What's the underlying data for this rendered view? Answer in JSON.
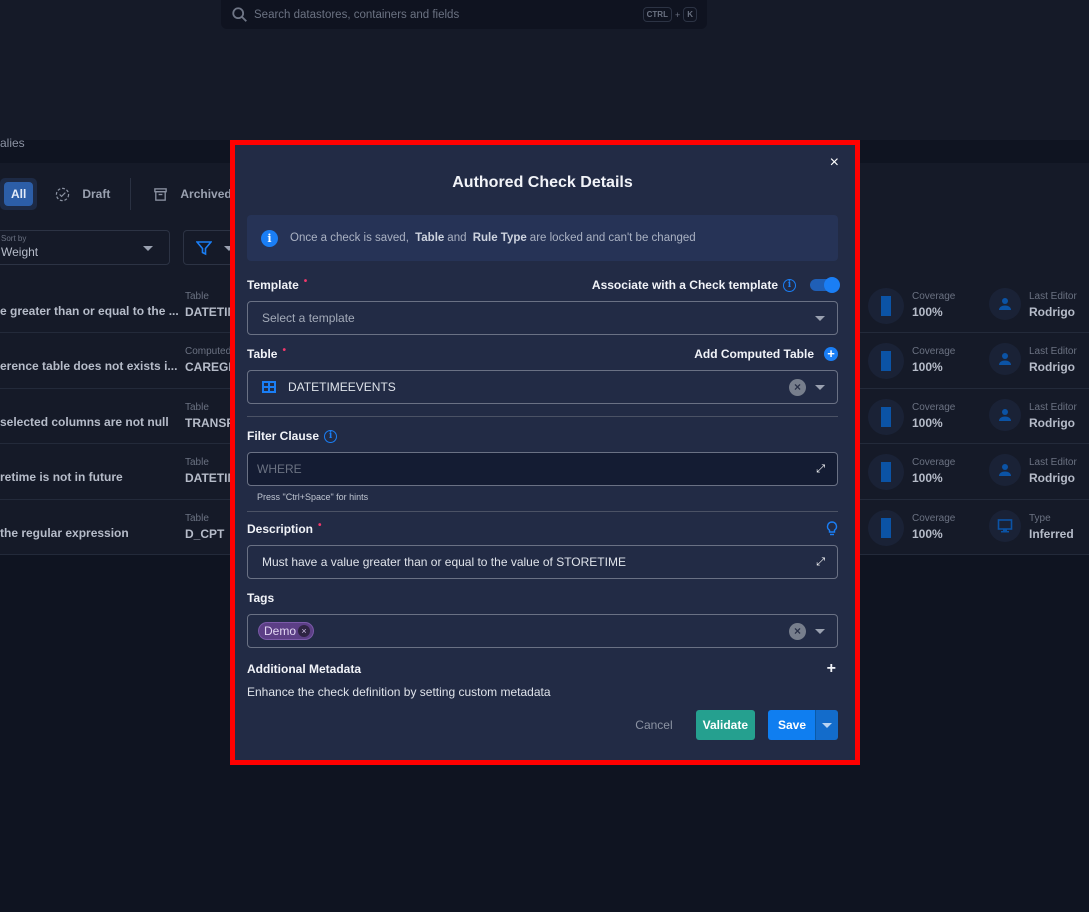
{
  "search": {
    "placeholder": "Search datastores, containers and fields",
    "shortcut_key1": "CTRL",
    "shortcut_plus": "+",
    "shortcut_key2": "K"
  },
  "page": {
    "title_fragment": "alies"
  },
  "tabs": [
    {
      "label": "All",
      "active": true
    },
    {
      "label": "Draft",
      "icon": "draft-circle-icon"
    },
    {
      "label": "Archived",
      "icon": "archive-icon"
    }
  ],
  "sort": {
    "label": "Sort by",
    "value": "Weight"
  },
  "rows": [
    {
      "name": "e greater than or equal to the ...",
      "container_label": "Table",
      "container": "DATETIM",
      "coverage_label": "Coverage",
      "coverage": "100%",
      "meta_label": "Last Editor",
      "meta_value": "Rodrigo",
      "meta_icon": "user-icon"
    },
    {
      "name": "erence table does not exists i...",
      "container_label": "Computed",
      "container": "CAREGIV",
      "coverage_label": "Coverage",
      "coverage": "100%",
      "meta_label": "Last Editor",
      "meta_value": "Rodrigo",
      "meta_icon": "user-icon"
    },
    {
      "name": "selected columns are not null",
      "container_label": "Table",
      "container": "TRANSFI",
      "coverage_label": "Coverage",
      "coverage": "100%",
      "meta_label": "Last Editor",
      "meta_value": "Rodrigo",
      "meta_icon": "user-icon"
    },
    {
      "name": "retime is not in future",
      "container_label": "Table",
      "container": "DATETIM",
      "coverage_label": "Coverage",
      "coverage": "100%",
      "meta_label": "Last Editor",
      "meta_value": "Rodrigo",
      "meta_icon": "user-icon"
    },
    {
      "name": "the regular expression",
      "container_label": "Table",
      "container": "D_CPT",
      "coverage_label": "Coverage",
      "coverage": "100%",
      "meta_label": "Type",
      "meta_value": "Inferred",
      "meta_icon": "monitor-icon"
    }
  ],
  "modal": {
    "title": "Authored Check Details",
    "close_label": "×",
    "info": {
      "prefix": "Once a check is saved,",
      "bold1": "Table",
      "mid": "and",
      "bold2": "Rule Type",
      "suffix": "are locked and can't be changed"
    },
    "template": {
      "label": "Template",
      "required_mark": "•",
      "associate_label": "Associate with a Check template",
      "associate_enabled": true,
      "placeholder": "Select a template"
    },
    "table": {
      "label": "Table",
      "required_mark": "•",
      "add_computed_label": "Add Computed Table",
      "value": "DATETIMEEVENTS"
    },
    "filter": {
      "label": "Filter Clause",
      "placeholder": "WHERE",
      "hint": "Press \"Ctrl+Space\" for hints"
    },
    "description": {
      "label": "Description",
      "required_mark": "•",
      "value": "Must have a value greater than or equal to the value of STORETIME"
    },
    "tags": {
      "label": "Tags",
      "items": [
        "Demo"
      ]
    },
    "metadata": {
      "label": "Additional Metadata",
      "add_label": "+",
      "description": "Enhance the check definition by setting custom metadata"
    },
    "footer": {
      "cancel_label": "Cancel",
      "validate_label": "Validate",
      "save_label": "Save"
    }
  },
  "colors": {
    "accent": "#1a7ef5",
    "validate": "#25a08f",
    "highlight": "#ff0000",
    "required": "#f0386b",
    "tag": "#5c3f86"
  }
}
